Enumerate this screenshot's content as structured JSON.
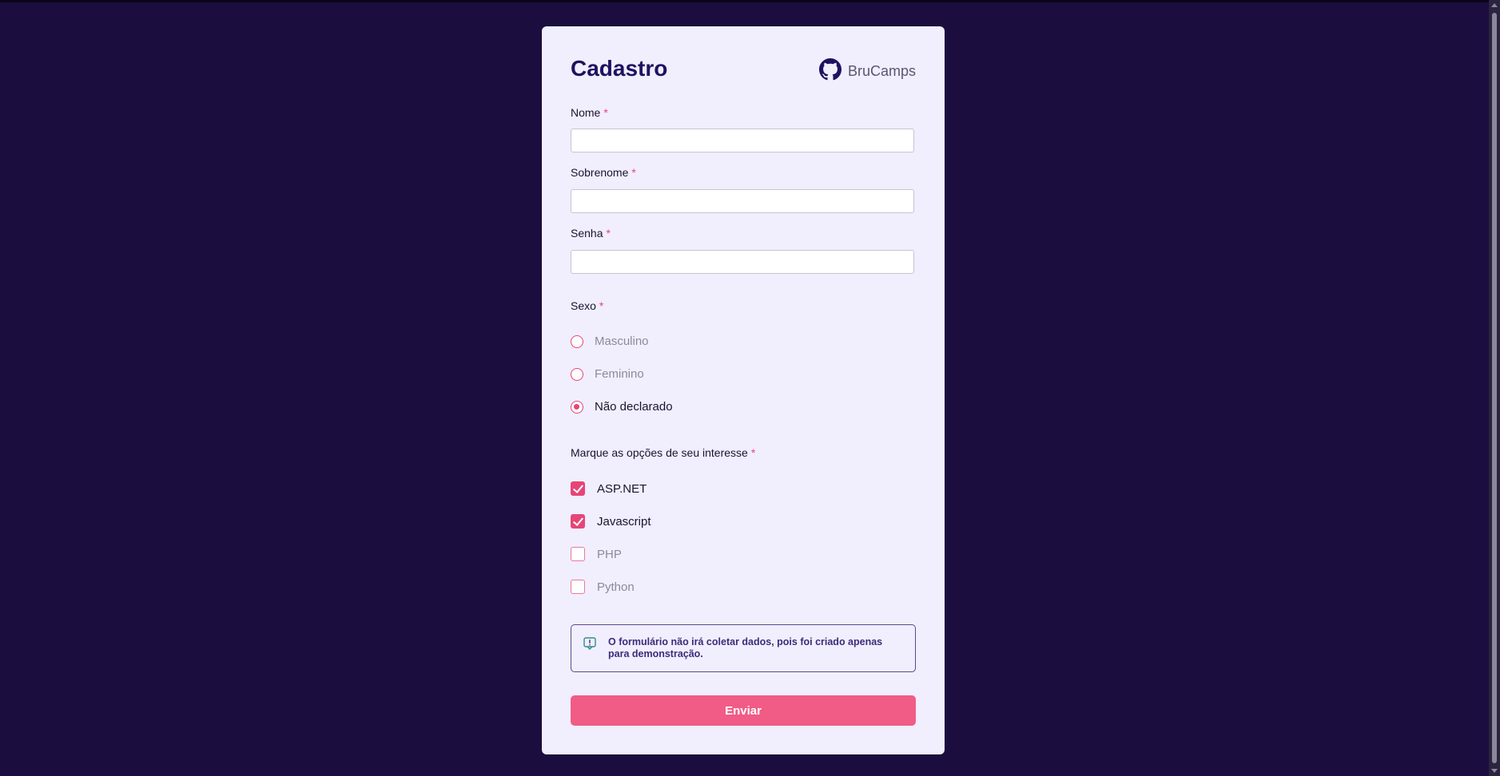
{
  "form": {
    "title": "Cadastro",
    "brand": {
      "name": "BruCamps",
      "icon": "github-icon"
    },
    "required_mark": "*",
    "fields": {
      "nome": {
        "label": "Nome",
        "value": "",
        "placeholder": ""
      },
      "sobrenome": {
        "label": "Sobrenome",
        "value": "",
        "placeholder": ""
      },
      "senha": {
        "label": "Senha",
        "value": "",
        "placeholder": ""
      }
    },
    "sexo": {
      "label": "Sexo",
      "options": [
        {
          "label": "Masculino",
          "checked": false
        },
        {
          "label": "Feminino",
          "checked": false
        },
        {
          "label": "Não declarado",
          "checked": true
        }
      ]
    },
    "interesses": {
      "label": "Marque as opções de seu interesse",
      "options": [
        {
          "label": "ASP.NET",
          "checked": true
        },
        {
          "label": "Javascript",
          "checked": true
        },
        {
          "label": "PHP",
          "checked": false
        },
        {
          "label": "Python",
          "checked": false
        }
      ]
    },
    "notice": {
      "icon": "alert-icon",
      "text": "O formulário não irá coletar dados, pois foi criado apenas para demonstração."
    },
    "submit_label": "Enviar"
  },
  "colors": {
    "background": "#1c0d3f",
    "card": "#f1eefd",
    "accent": "#e64577",
    "button": "#f05c86",
    "title": "#1f1260"
  }
}
